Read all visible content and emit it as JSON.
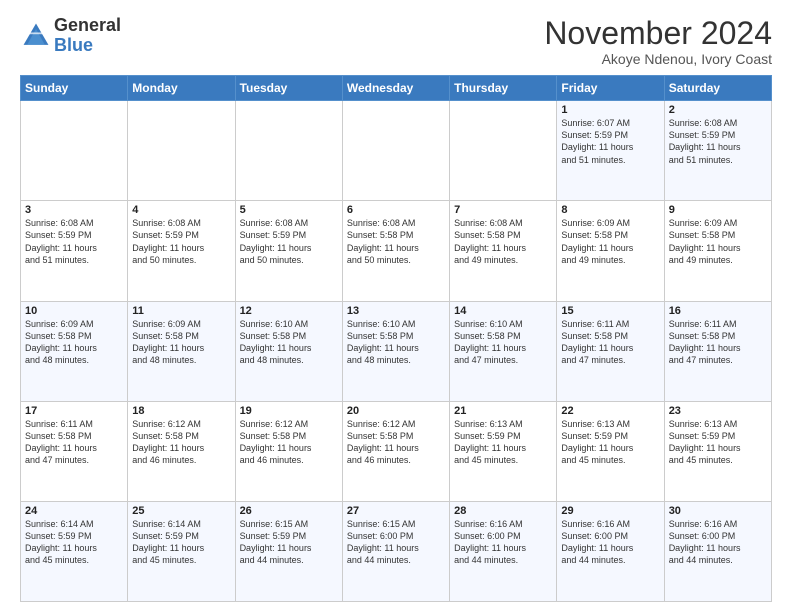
{
  "header": {
    "logo_line1": "General",
    "logo_line2": "Blue",
    "month_title": "November 2024",
    "location": "Akoye Ndenou, Ivory Coast"
  },
  "weekdays": [
    "Sunday",
    "Monday",
    "Tuesday",
    "Wednesday",
    "Thursday",
    "Friday",
    "Saturday"
  ],
  "weeks": [
    [
      {
        "day": "",
        "info": ""
      },
      {
        "day": "",
        "info": ""
      },
      {
        "day": "",
        "info": ""
      },
      {
        "day": "",
        "info": ""
      },
      {
        "day": "",
        "info": ""
      },
      {
        "day": "1",
        "info": "Sunrise: 6:07 AM\nSunset: 5:59 PM\nDaylight: 11 hours\nand 51 minutes."
      },
      {
        "day": "2",
        "info": "Sunrise: 6:08 AM\nSunset: 5:59 PM\nDaylight: 11 hours\nand 51 minutes."
      }
    ],
    [
      {
        "day": "3",
        "info": "Sunrise: 6:08 AM\nSunset: 5:59 PM\nDaylight: 11 hours\nand 51 minutes."
      },
      {
        "day": "4",
        "info": "Sunrise: 6:08 AM\nSunset: 5:59 PM\nDaylight: 11 hours\nand 50 minutes."
      },
      {
        "day": "5",
        "info": "Sunrise: 6:08 AM\nSunset: 5:59 PM\nDaylight: 11 hours\nand 50 minutes."
      },
      {
        "day": "6",
        "info": "Sunrise: 6:08 AM\nSunset: 5:58 PM\nDaylight: 11 hours\nand 50 minutes."
      },
      {
        "day": "7",
        "info": "Sunrise: 6:08 AM\nSunset: 5:58 PM\nDaylight: 11 hours\nand 49 minutes."
      },
      {
        "day": "8",
        "info": "Sunrise: 6:09 AM\nSunset: 5:58 PM\nDaylight: 11 hours\nand 49 minutes."
      },
      {
        "day": "9",
        "info": "Sunrise: 6:09 AM\nSunset: 5:58 PM\nDaylight: 11 hours\nand 49 minutes."
      }
    ],
    [
      {
        "day": "10",
        "info": "Sunrise: 6:09 AM\nSunset: 5:58 PM\nDaylight: 11 hours\nand 48 minutes."
      },
      {
        "day": "11",
        "info": "Sunrise: 6:09 AM\nSunset: 5:58 PM\nDaylight: 11 hours\nand 48 minutes."
      },
      {
        "day": "12",
        "info": "Sunrise: 6:10 AM\nSunset: 5:58 PM\nDaylight: 11 hours\nand 48 minutes."
      },
      {
        "day": "13",
        "info": "Sunrise: 6:10 AM\nSunset: 5:58 PM\nDaylight: 11 hours\nand 48 minutes."
      },
      {
        "day": "14",
        "info": "Sunrise: 6:10 AM\nSunset: 5:58 PM\nDaylight: 11 hours\nand 47 minutes."
      },
      {
        "day": "15",
        "info": "Sunrise: 6:11 AM\nSunset: 5:58 PM\nDaylight: 11 hours\nand 47 minutes."
      },
      {
        "day": "16",
        "info": "Sunrise: 6:11 AM\nSunset: 5:58 PM\nDaylight: 11 hours\nand 47 minutes."
      }
    ],
    [
      {
        "day": "17",
        "info": "Sunrise: 6:11 AM\nSunset: 5:58 PM\nDaylight: 11 hours\nand 47 minutes."
      },
      {
        "day": "18",
        "info": "Sunrise: 6:12 AM\nSunset: 5:58 PM\nDaylight: 11 hours\nand 46 minutes."
      },
      {
        "day": "19",
        "info": "Sunrise: 6:12 AM\nSunset: 5:58 PM\nDaylight: 11 hours\nand 46 minutes."
      },
      {
        "day": "20",
        "info": "Sunrise: 6:12 AM\nSunset: 5:58 PM\nDaylight: 11 hours\nand 46 minutes."
      },
      {
        "day": "21",
        "info": "Sunrise: 6:13 AM\nSunset: 5:59 PM\nDaylight: 11 hours\nand 45 minutes."
      },
      {
        "day": "22",
        "info": "Sunrise: 6:13 AM\nSunset: 5:59 PM\nDaylight: 11 hours\nand 45 minutes."
      },
      {
        "day": "23",
        "info": "Sunrise: 6:13 AM\nSunset: 5:59 PM\nDaylight: 11 hours\nand 45 minutes."
      }
    ],
    [
      {
        "day": "24",
        "info": "Sunrise: 6:14 AM\nSunset: 5:59 PM\nDaylight: 11 hours\nand 45 minutes."
      },
      {
        "day": "25",
        "info": "Sunrise: 6:14 AM\nSunset: 5:59 PM\nDaylight: 11 hours\nand 45 minutes."
      },
      {
        "day": "26",
        "info": "Sunrise: 6:15 AM\nSunset: 5:59 PM\nDaylight: 11 hours\nand 44 minutes."
      },
      {
        "day": "27",
        "info": "Sunrise: 6:15 AM\nSunset: 6:00 PM\nDaylight: 11 hours\nand 44 minutes."
      },
      {
        "day": "28",
        "info": "Sunrise: 6:16 AM\nSunset: 6:00 PM\nDaylight: 11 hours\nand 44 minutes."
      },
      {
        "day": "29",
        "info": "Sunrise: 6:16 AM\nSunset: 6:00 PM\nDaylight: 11 hours\nand 44 minutes."
      },
      {
        "day": "30",
        "info": "Sunrise: 6:16 AM\nSunset: 6:00 PM\nDaylight: 11 hours\nand 44 minutes."
      }
    ]
  ]
}
